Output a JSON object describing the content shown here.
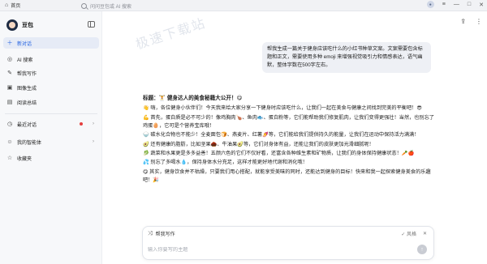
{
  "window": {
    "home_tab_label": "首页",
    "search_placeholder": "问问豆包或 AI 搜索"
  },
  "sidebar": {
    "brand_name": "豆包",
    "items": [
      {
        "label": "新对话",
        "icon": "plus-icon",
        "active": true
      },
      {
        "label": "AI 搜索",
        "icon": "search-icon"
      },
      {
        "label": "帮我写作",
        "icon": "pen-icon"
      },
      {
        "label": "图像生成",
        "icon": "image-icon"
      },
      {
        "label": "阅读总结",
        "icon": "book-icon"
      },
      {
        "label": "最近对话",
        "icon": "clock-icon"
      },
      {
        "label": "我的智能体",
        "icon": "bot-icon"
      },
      {
        "label": "收藏夹",
        "icon": "star-icon"
      }
    ]
  },
  "watermark": "极速下载站",
  "conversation": {
    "user_message": "帮我生成一篇关于健身应该吃什么的小红书种草文案。文案需要包含标题和正文，需要使用多种 emoji 来增强视觉吸引力和情感表达，语气幽默，整体字数在500字左右。",
    "answer": {
      "title": "标题：🏋️ 健身达人的美食秘籍大公开！😋",
      "paragraphs": [
        "👋 嗨，各位健身小伙伴们！今天我来给大家分享一下健身时应该吃什么，让我们一起在美食与健康之间找到完美的平衡吧！😎",
        "💪 首先，蛋白质是必不可少的！像鸡胸肉🍗、鱼肉🐟、蛋白粉等，它们能帮助我们修复肌肉，让我们变得更强壮！当然，也别忘了鸡蛋🥚，它可是个营养宝库哦！",
        "🍚 碳水化合物也不能少！全麦面包🍞、燕麦片、红薯🍠等，它们能给我们提供持久的能量，让我们在运动中保持活力满满！",
        "🥑 还有健康的脂肪，比如坚果🌰、牛油果🥑等，它们对身体有益，还能让我们的皮肤更加光滑细腻呢！",
        "🥬 蔬菜和水果更是多多益善！五颜六色的它们不仅好看，还富含各种维生素和矿物质，让我们的身体保持健康状态！🥕🍎",
        "💦 别忘了多喝水💧，保持身体水分充足，这样才能更好地代谢和消化哦！",
        "😋 其实，健身饮食并不枯燥，只要我们用心搭配，就能享受美味的同时，还能达到健身的目标！快来和我一起探索健身美食的乐趣吧！🎉"
      ]
    }
  },
  "composer": {
    "mode_label": "帮我写作",
    "style_label": "风格",
    "placeholder": "输入你要写的主题"
  }
}
